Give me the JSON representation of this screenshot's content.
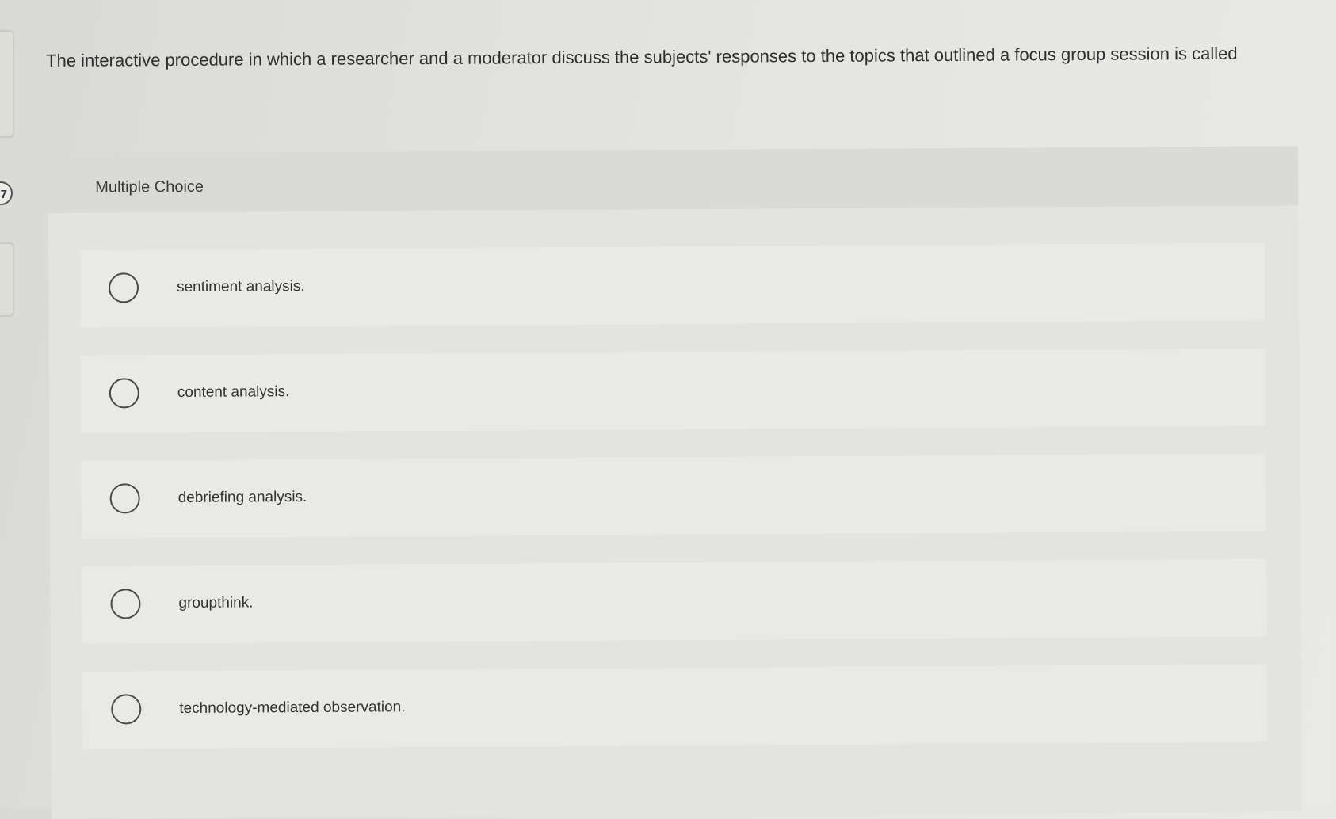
{
  "question": {
    "number": "7",
    "text": "The interactive procedure in which a researcher and a moderator discuss the subjects' responses to the topics that outlined a focus group session is called",
    "type_label": "Multiple Choice"
  },
  "options": [
    {
      "label": "sentiment analysis."
    },
    {
      "label": "content analysis."
    },
    {
      "label": "debriefing analysis."
    },
    {
      "label": "groupthink."
    },
    {
      "label": "technology-mediated observation."
    }
  ]
}
